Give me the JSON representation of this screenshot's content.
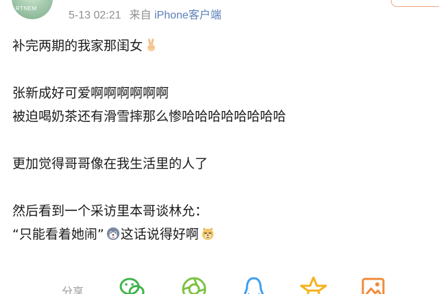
{
  "header": {
    "avatar_text": "RTNEM",
    "timestamp": "5-13 02:21",
    "source_prefix": "来自",
    "source_app": "iPhone客户端"
  },
  "post": {
    "line1": "补完两期的我家那闺女",
    "line2": "张新成好可爱啊啊啊啊啊啊",
    "line3": "被迫喝奶茶还有滑雪摔那么惨哈哈哈哈哈哈哈哈",
    "line4": "更加觉得哥哥像在我生活里的人了",
    "line5": "然后看到一个采访里本哥谈林允：",
    "line6_quote": "“只能看着她闹”",
    "line6_tail": "这话说得好啊"
  },
  "actions": {
    "share_label": "分享",
    "icons": [
      "wechat-icon",
      "moments-icon",
      "qq-icon",
      "qzone-star-icon",
      "image-icon"
    ]
  },
  "colors": {
    "text": "#1a1a1a",
    "meta": "#8f8f8f",
    "source": "#5b7fb8",
    "wechat": "#3fb44a",
    "moments": "#7cc142",
    "qq": "#3d9cf0",
    "qzone": "#f5b21a",
    "image": "#f08a3a"
  }
}
